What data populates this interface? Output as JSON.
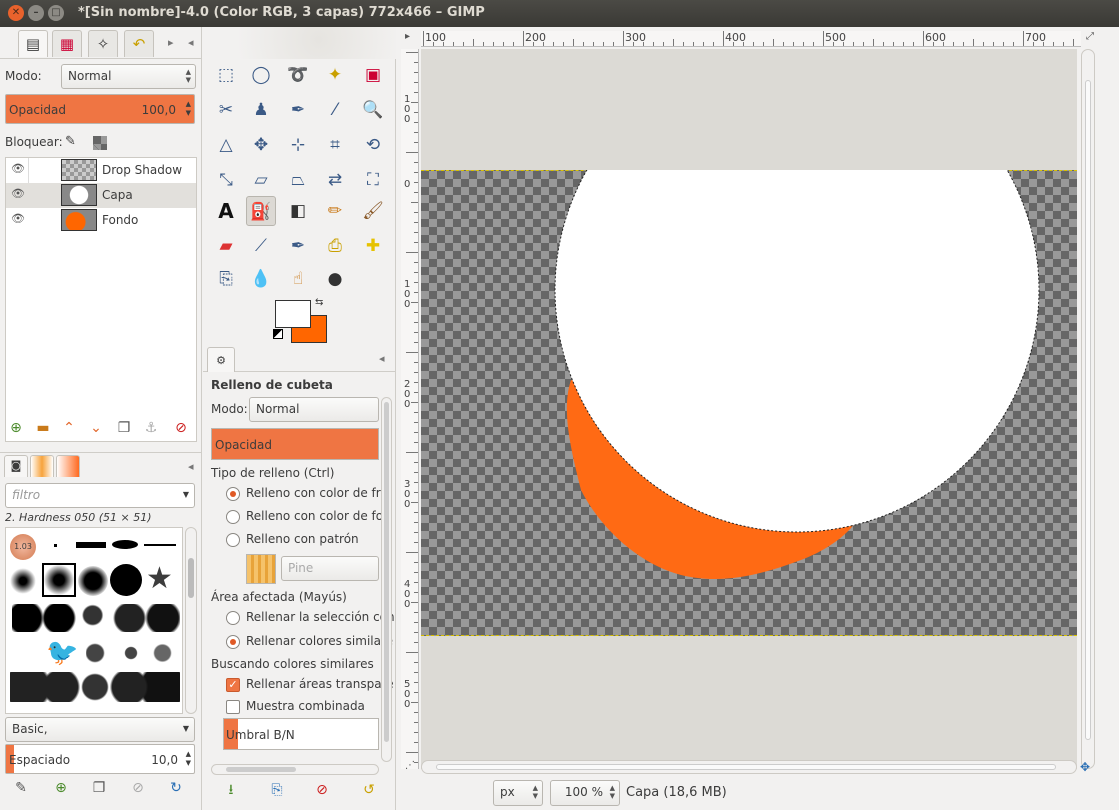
{
  "window": {
    "title": "*[Sin nombre]-4.0 (Color RGB, 3 capas) 772x466 – GIMP"
  },
  "layers_panel": {
    "mode_label": "Modo:",
    "mode_value": "Normal",
    "opacity_label": "Opacidad",
    "opacity_value": "100,0",
    "lock_label": "Bloquear:",
    "layers": [
      {
        "name": "Drop Shadow"
      },
      {
        "name": "Capa"
      },
      {
        "name": "Fondo"
      }
    ]
  },
  "brushes_panel": {
    "filter_placeholder": "filtro",
    "brush_name": "2. Hardness 050 (51 × 51)",
    "preset_value": "Basic,",
    "spacing_label": "Espaciado",
    "spacing_value": "10,0",
    "first_brush_label": "1.03"
  },
  "tool_options": {
    "title": "Relleno de cubeta",
    "mode_label": "Modo:",
    "mode_value": "Normal",
    "opacity_label": "Opacidad",
    "fill_type_label": "Tipo de relleno  (Ctrl)",
    "fill_fg": "Relleno con color de fre",
    "fill_bg": "Relleno con color de fon",
    "fill_pattern": "Relleno con patrón",
    "pattern_name": "Pine",
    "area_label": "Área afectada  (Mayús)",
    "area_selection": "Rellenar la selección con",
    "area_similar": "Rellenar colores similare",
    "similar_label": "Buscando colores similares",
    "fill_transparent": "Rellenar áreas transpare",
    "sample_merged": "Muestra combinada",
    "threshold_label": "Umbral B/N"
  },
  "rulers": {
    "h_labels": [
      "100",
      "200",
      "300",
      "400",
      "500",
      "600",
      "700"
    ],
    "v_labels": [
      "1\n0\n0",
      "0",
      "1\n0\n0",
      "2\n0\n0",
      "3\n0\n0",
      "4\n0\n0",
      "5\n0\n0"
    ]
  },
  "statusbar": {
    "unit": "px",
    "zoom": "100 %",
    "info": "Capa (18,6 MB)"
  },
  "colors": {
    "accent": "#ef7543",
    "foreground": "#ffffff",
    "background": "#ff6600",
    "titlebar": "#3c3b37"
  }
}
